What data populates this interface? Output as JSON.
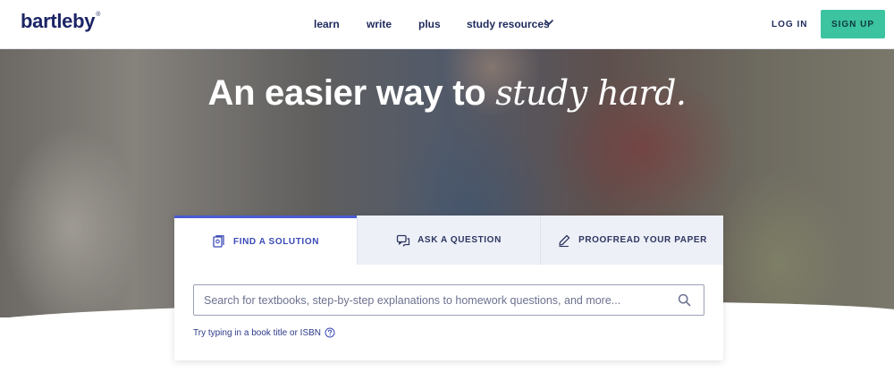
{
  "header": {
    "logo_text": "bartleby",
    "logo_mark": "®",
    "nav": {
      "learn": "learn",
      "write": "write",
      "plus": "plus",
      "study_resources": "study resources"
    },
    "login_label": "LOG IN",
    "signup_label": "SIGN UP"
  },
  "hero": {
    "headline_plain": "An easier way to ",
    "headline_accent": "study hard."
  },
  "search_card": {
    "tabs": [
      {
        "label": "FIND A SOLUTION",
        "icon": "textbook-icon",
        "active": true
      },
      {
        "label": "ASK A QUESTION",
        "icon": "chat-icon",
        "active": false
      },
      {
        "label": "PROOFREAD YOUR PAPER",
        "icon": "pen-icon",
        "active": false
      }
    ],
    "search_placeholder": "Search for textbooks, step-by-step explanations to homework questions, and more...",
    "hint_text": "Try typing in a book title or ISBN"
  },
  "colors": {
    "brand_navy": "#1b2566",
    "accent_green": "#3cc3a0",
    "active_tab_blue": "#4a5bd4"
  }
}
